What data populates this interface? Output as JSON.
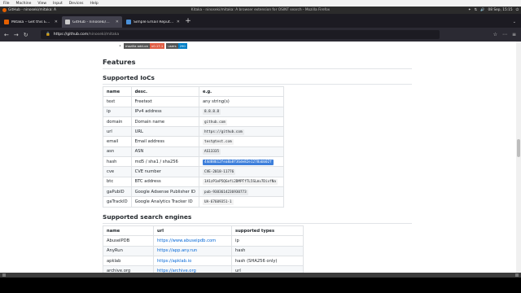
{
  "vm_menu": [
    "File",
    "Machine",
    "View",
    "Input",
    "Devices",
    "Help"
  ],
  "top_panel": {
    "app_label": "GitHub - ninoseki/mitaka: A",
    "window_title": "Kitaka - ninoseki/mitaka: A browser extension for OSINT search - Mozilla Firefox",
    "tray": [
      "✦",
      "⇅",
      "🔊",
      "⏻"
    ],
    "clock": "08 Sep, 15:15"
  },
  "tabs": [
    {
      "label": "Mitaka – Get this Extension",
      "icon_color": "#e66000"
    },
    {
      "label": "GitHub - ninoseki/mitaka: A",
      "icon_color": "#cccccc"
    },
    {
      "label": "Simple Email Reputation",
      "icon_color": "#4a90d9"
    }
  ],
  "tabbar_right": "⌄",
  "nav": {
    "back": "←",
    "forward": "→",
    "reload": "↻",
    "url_host": "https://github.com",
    "url_path": "/ninoseki/mitaka",
    "right_icons": [
      "☆",
      "⋯",
      "≡"
    ]
  },
  "badges": [
    {
      "left": "mozilla add-on",
      "right": "v0.17.1",
      "color": "#e05d44"
    },
    {
      "left": "users",
      "right": "290",
      "color": "#007ec6"
    }
  ],
  "features_title": "Features",
  "iocs": {
    "title": "Supported IoCs",
    "headers": [
      "name",
      "desc.",
      "e.g."
    ],
    "rows": [
      {
        "name": "text",
        "desc": "Freetext",
        "eg": "any string(s)",
        "code": false,
        "sel": false
      },
      {
        "name": "ip",
        "desc": "IPv4 address",
        "eg": "8.8.8.8",
        "code": true,
        "sel": false
      },
      {
        "name": "domain",
        "desc": "Domain name",
        "eg": "github.com",
        "code": true,
        "sel": false
      },
      {
        "name": "url",
        "desc": "URL",
        "eg": "https://github.com",
        "code": true,
        "sel": false
      },
      {
        "name": "email",
        "desc": "Email address",
        "eg": "test@test.com",
        "code": true,
        "sel": false
      },
      {
        "name": "asn",
        "desc": "ASN",
        "eg": "AS13335",
        "code": true,
        "sel": false
      },
      {
        "name": "hash",
        "desc": "md5 / sha1 / sha256",
        "eg": "44d88612fea8a8f36de82e1278abb02f",
        "code": true,
        "sel": true
      },
      {
        "name": "cve",
        "desc": "CVE number",
        "eg": "CVE-2018-11776",
        "code": true,
        "sel": false
      },
      {
        "name": "btc",
        "desc": "BTC address",
        "eg": "1A1zP1eP5QGefi2DMPTfTL5SLmv7DivfNa",
        "code": true,
        "sel": false
      },
      {
        "name": "gaPubID",
        "desc": "Google Adsense Publisher ID",
        "eg": "pub-9383614236930773",
        "code": true,
        "sel": false
      },
      {
        "name": "gaTrackID",
        "desc": "Google Analytics Tracker ID",
        "eg": "UA-67609351-1",
        "code": true,
        "sel": false
      }
    ]
  },
  "engines": {
    "title": "Supported search engines",
    "headers": [
      "name",
      "url",
      "supported types"
    ],
    "rows": [
      {
        "name": "AbuseIPDB",
        "url": "https://www.abuseipdb.com",
        "types": "ip"
      },
      {
        "name": "AnyRun",
        "url": "https://app.any.run",
        "types": "hash"
      },
      {
        "name": "apklab",
        "url": "https://apklab.io",
        "types": "hash (SHA256 only)"
      },
      {
        "name": "archive.org",
        "url": "https://archive.org",
        "types": "url"
      }
    ]
  }
}
